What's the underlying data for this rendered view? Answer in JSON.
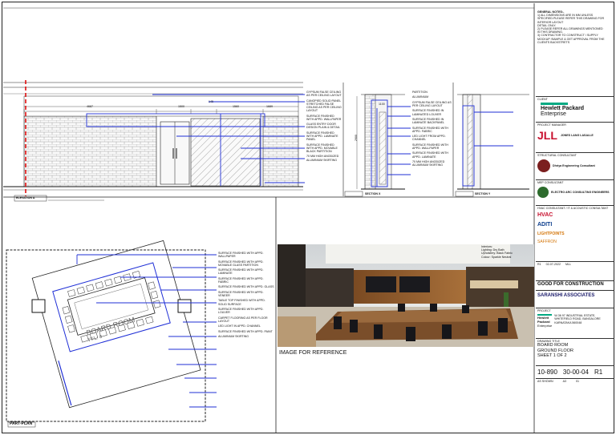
{
  "general_notes": {
    "heading": "GENERAL NOTES:-",
    "lines": [
      "1) ALL DIMENSIONS ARE IN MM UNLESS",
      "SPECIFIED.PLEASE REFER THIS DRAWING FOR",
      "INTERIOR LAYOUT",
      "DETAIL ONLY.",
      "2) PLEASE REFER ALL DRAWINGS MENTIONED",
      "IN THIS DRAWING.",
      "3) CONTRACTOR TO CONSTRUCT / SUPPLY",
      "MOCKUP /SAMPLE & GET APPROVAL FROM THE",
      "CLIENTS BACKSTRETS"
    ]
  },
  "elevation": {
    "title": "ELEVATION A",
    "dims": [
      "4687",
      "1500",
      "145",
      "1560",
      "1689"
    ],
    "notes": [
      "GYPSUM FALSE CEILING AS PER CEILING LAYOUT",
      "CANOPIED SOLID PANEL STRETCHED FALSE CEILING AS PER CEILING LAYOUT",
      "SURFACE FINISHED WITH APPD. WALLPAPER",
      "GLASS ENTRY DOOR DESIGN PLAIN & DETAIL",
      "SURFACE FINISHED WITH APPD. LAMINATE PANEL",
      "SURFACE FINISHED WITH APPD. MOVABLE BLACK PARTITION",
      "70 MM HIGH ANODIZED ALUMINIUM SKIRTING"
    ]
  },
  "section_x": {
    "title": "SECTION X",
    "height_dim": "2900",
    "top_dim": "1100",
    "notes": [
      "PARTITION",
      "ALUMINIUM",
      "GYPSUM FALSE CEILING AS PER CEILING LAYOUT",
      "SURFACE FINISHED IN LAMINATED LOUVER",
      "SURFACE FINISHED IN LAMINATE BACKPANEL",
      "SURFACE FINISHED WITH APPD. FABRIC",
      "LED LIGHT FROM APPD. CHANNEL",
      "SURFACE FINISHED WITH APPD. WALLPAPER",
      "SURFACE FINISHED WITH APPD. LAMINATE",
      "70 MM HIGH ANODIZED ALUMINIUM SKIRTING"
    ]
  },
  "section_y": {
    "title": "SECTION Y"
  },
  "plan": {
    "title": "PART-PLAN",
    "room_label": "BOARD ROOM",
    "room_area": "FFL: 0",
    "notes": [
      "SURFACE FINISHED WITH APPD. WALLPAPER",
      "SURFACE FINISHED WITH APPD. MOVABLE GLASS PARTITION",
      "SURFACE FINISHED WITH APPD. LAMINATE",
      "SURFACE FINISHED WITH APPD. FABRIC",
      "SURFACE FINISHED WITH APPD. GLASS",
      "SURFACE FINISHED WITH APPD. VENEER",
      "TABLE TOP FINISHED WITH APPD. SOLID SURFACE",
      "SURFACE FINISHED WITH APPD. LOUVER",
      "CARPET FLOORING AS PER FLOOR LAYOUT",
      "LED LIGHT IN APPD. CHANNEL",
      "SURFACE FINISHED WITH APPD. PAINT",
      "ALUMINIUM SKIRTING"
    ]
  },
  "reference": {
    "caption": "IMAGE FOR REFERENCE",
    "notes": [
      "Interiors:",
      "Lighting: Dry Bath",
      "Upholstery: Black Fabric",
      "Colour: Sparkle Neutral"
    ]
  },
  "title_block": {
    "client_label": "CLIENT",
    "client_name_1": "Hewlett Packard",
    "client_name_2": "Enterprise",
    "pm_label": "PROJECT MANAGER",
    "pm_logo": "JLL",
    "pm_name": "JONES LANG LASALLE",
    "structural_label": "STRUCTURAL CONSULTANT",
    "structural_name": "Dhriya Engineering Consultant",
    "mep_label": "MEP CONSULTANT",
    "mep_name": "ELECTRO ARC CONSULTING ENGINEERS",
    "hvac_label": "HVAC CONSULTANT / IT & ACOUSTIC CONSULTANT",
    "hvac_name": "HVAC",
    "aditi_name": "ADITI",
    "lightpoints_name": "LIGHTPOINTS",
    "saffron_name": "SAFFRON",
    "rev": "R1",
    "rev_date": "02-07-2022",
    "rev_by": "MLL",
    "status": "GOOD FOR CONSTRUCTION",
    "architect": "SARANSHI ASSOCIATES",
    "project_label": "PROJECT",
    "project_address": "W-36 97 INDUSTRIAL ESTATE, WHITEFIELD ROAD, BANGALORE KARNATAKA 560048",
    "client_short_1": "Hewlett Packard",
    "client_short_2": "Enterprise",
    "drawing_label": "DRAWING TITLE",
    "drawing_title_1": "BOARD ROOM",
    "drawing_title_2": "GROUND FLOOR",
    "drawing_title_3": "SHEET 1 OF 2",
    "drawing_no": "10-890",
    "date": "30-00-04",
    "revision": "R1",
    "scale": "AS SHOWN",
    "size": "A3",
    "sheet": "01"
  }
}
